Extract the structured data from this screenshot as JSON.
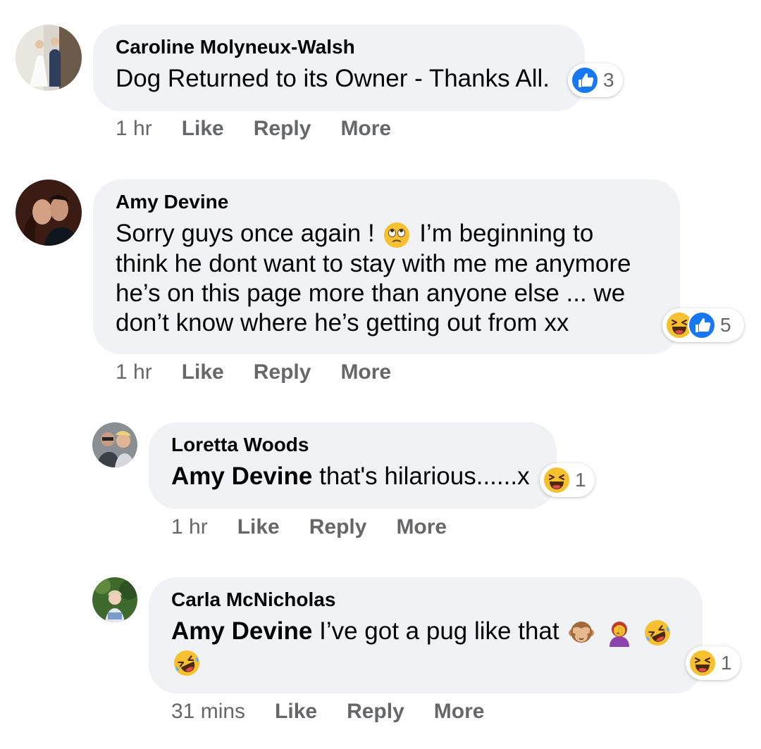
{
  "colors": {
    "bubble": "#f0f2f5",
    "secondary_text": "#65676b",
    "like_blue": "#1877f2",
    "emoji_yellow": "#f7c02f"
  },
  "comments": [
    {
      "author": "Caroline Molyneux-Walsh",
      "segments": [
        {
          "type": "text",
          "value": "Dog Returned to its Owner - Thanks All."
        }
      ],
      "reactions": {
        "icons": [
          "like-icon"
        ],
        "count": "3"
      },
      "time": "1 hr",
      "actions": [
        "Like",
        "Reply",
        "More"
      ]
    },
    {
      "author": "Amy Devine",
      "line1_a": "Sorry guys once again !",
      "line1_emoji": "face-with-rolling-eyes",
      "line1_b": "I’m beginning to",
      "line2": "think he dont want to stay with me me anymore",
      "line3": "he’s on this page more than anyone else ... we",
      "line4": "don’t know where he’s getting out from xx",
      "reactions": {
        "icons": [
          "haha-icon",
          "like-icon"
        ],
        "count": "5"
      },
      "time": "1 hr",
      "actions": [
        "Like",
        "Reply",
        "More"
      ]
    },
    {
      "author": "Loretta Woods",
      "mention": "Amy Devine",
      "text": "that's hilarious......x",
      "reactions": {
        "icons": [
          "haha-icon"
        ],
        "count": "1"
      },
      "time": "1 hr",
      "actions": [
        "Like",
        "Reply",
        "More"
      ]
    },
    {
      "author": "Carla McNicholas",
      "mention": "Amy Devine",
      "text": "I’ve got a pug like that",
      "emojis_line1": [
        "see-no-evil-monkey",
        "woman-facepalming",
        "rolling-on-floor-laughing"
      ],
      "emojis_line2": [
        "rolling-on-floor-laughing"
      ],
      "reactions": {
        "icons": [
          "haha-icon"
        ],
        "count": "1"
      },
      "time": "31 mins",
      "actions": [
        "Like",
        "Reply",
        "More"
      ]
    }
  ]
}
